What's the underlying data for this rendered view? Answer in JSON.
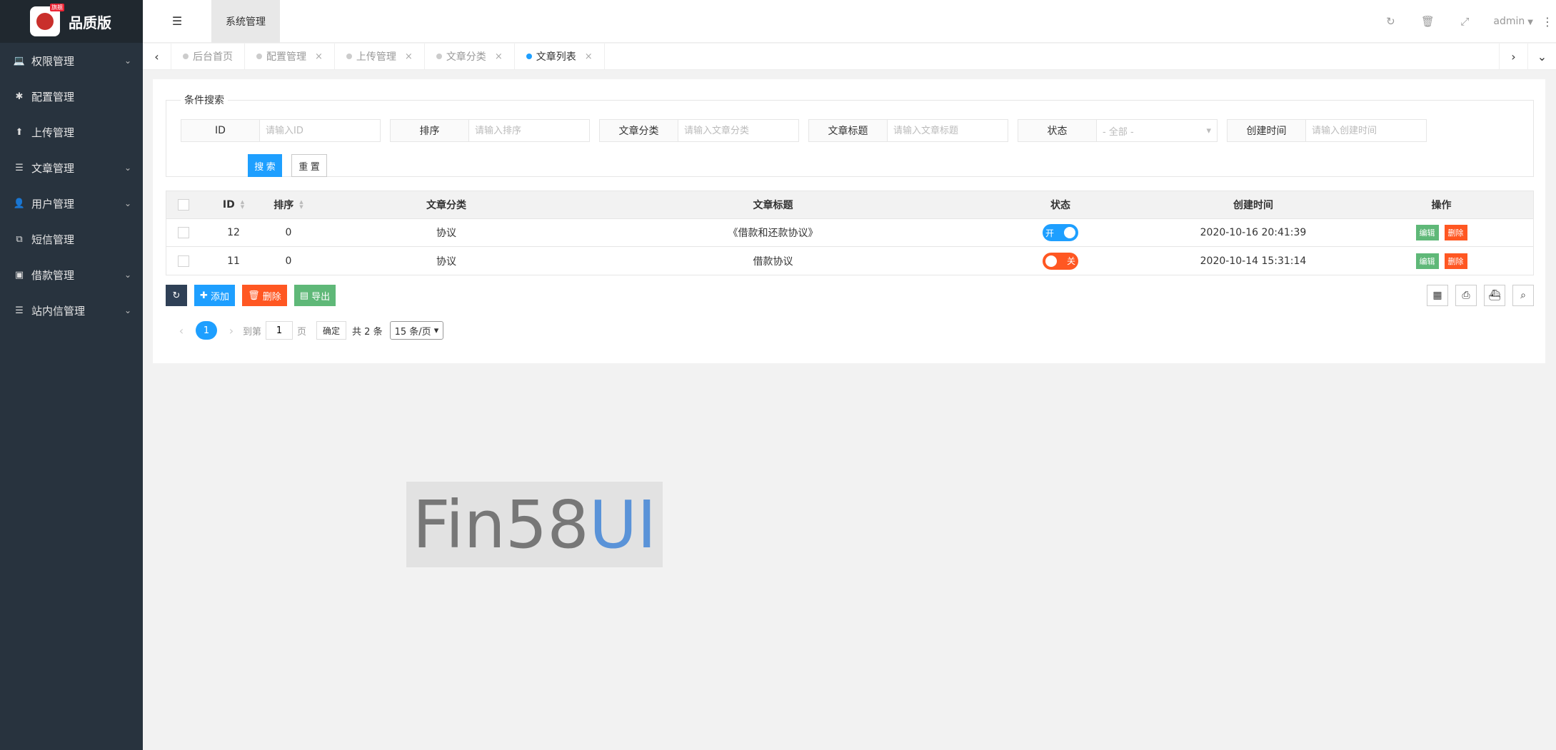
{
  "brand": {
    "name": "品质版",
    "badge": "旗舰"
  },
  "sidebar": {
    "items": [
      {
        "label": "权限管理",
        "icon": "laptop-icon",
        "expandable": true
      },
      {
        "label": "配置管理",
        "icon": "gear-icon",
        "expandable": false
      },
      {
        "label": "上传管理",
        "icon": "upload-icon",
        "expandable": false
      },
      {
        "label": "文章管理",
        "icon": "list-icon",
        "expandable": true
      },
      {
        "label": "用户管理",
        "icon": "user-icon",
        "expandable": true
      },
      {
        "label": "短信管理",
        "icon": "copy-icon",
        "expandable": false
      },
      {
        "label": "借款管理",
        "icon": "money-icon",
        "expandable": true
      },
      {
        "label": "站内信管理",
        "icon": "list-icon",
        "expandable": true
      }
    ]
  },
  "header": {
    "top_tab": "系统管理",
    "user": "admin"
  },
  "tabs": [
    {
      "label": "后台首页",
      "closable": false,
      "active": false
    },
    {
      "label": "配置管理",
      "closable": true,
      "active": false
    },
    {
      "label": "上传管理",
      "closable": true,
      "active": false
    },
    {
      "label": "文章分类",
      "closable": true,
      "active": false
    },
    {
      "label": "文章列表",
      "closable": true,
      "active": true
    }
  ],
  "search": {
    "legend": "条件搜索",
    "fields": [
      {
        "label": "ID",
        "placeholder": "请输入ID"
      },
      {
        "label": "排序",
        "placeholder": "请输入排序"
      },
      {
        "label": "文章分类",
        "placeholder": "请输入文章分类"
      },
      {
        "label": "文章标题",
        "placeholder": "请输入文章标题"
      },
      {
        "label": "状态",
        "select": "- 全部 -"
      },
      {
        "label": "创建时间",
        "placeholder": "请输入创建时间"
      }
    ],
    "search_label": "搜 索",
    "reset_label": "重 置"
  },
  "table": {
    "headers": [
      "ID",
      "排序",
      "文章分类",
      "文章标题",
      "状态",
      "创建时间",
      "操作"
    ],
    "rows": [
      {
        "id": "12",
        "sort": "0",
        "category": "协议",
        "title": "《借款和还款协议》",
        "status": "开",
        "status_on": true,
        "created": "2020-10-16 20:41:39"
      },
      {
        "id": "11",
        "sort": "0",
        "category": "协议",
        "title": "借款协议",
        "status": "关",
        "status_on": false,
        "created": "2020-10-14 15:31:14"
      }
    ],
    "edit_label": "编辑",
    "delete_label": "删除"
  },
  "toolbar": {
    "add_label": "添加",
    "delete_label": "删除",
    "export_label": "导出"
  },
  "pagination": {
    "current": "1",
    "goto_prefix": "到第",
    "goto_value": "1",
    "goto_suffix": "页",
    "confirm": "确定",
    "total": "共 2 条",
    "page_size": "15 条/页"
  },
  "watermark": {
    "part1": "Fin58",
    "part2": "UI"
  },
  "colors": {
    "sidebar": "#28333e",
    "primary": "#1e9fff",
    "danger": "#ff5722",
    "success": "#5fb878"
  }
}
